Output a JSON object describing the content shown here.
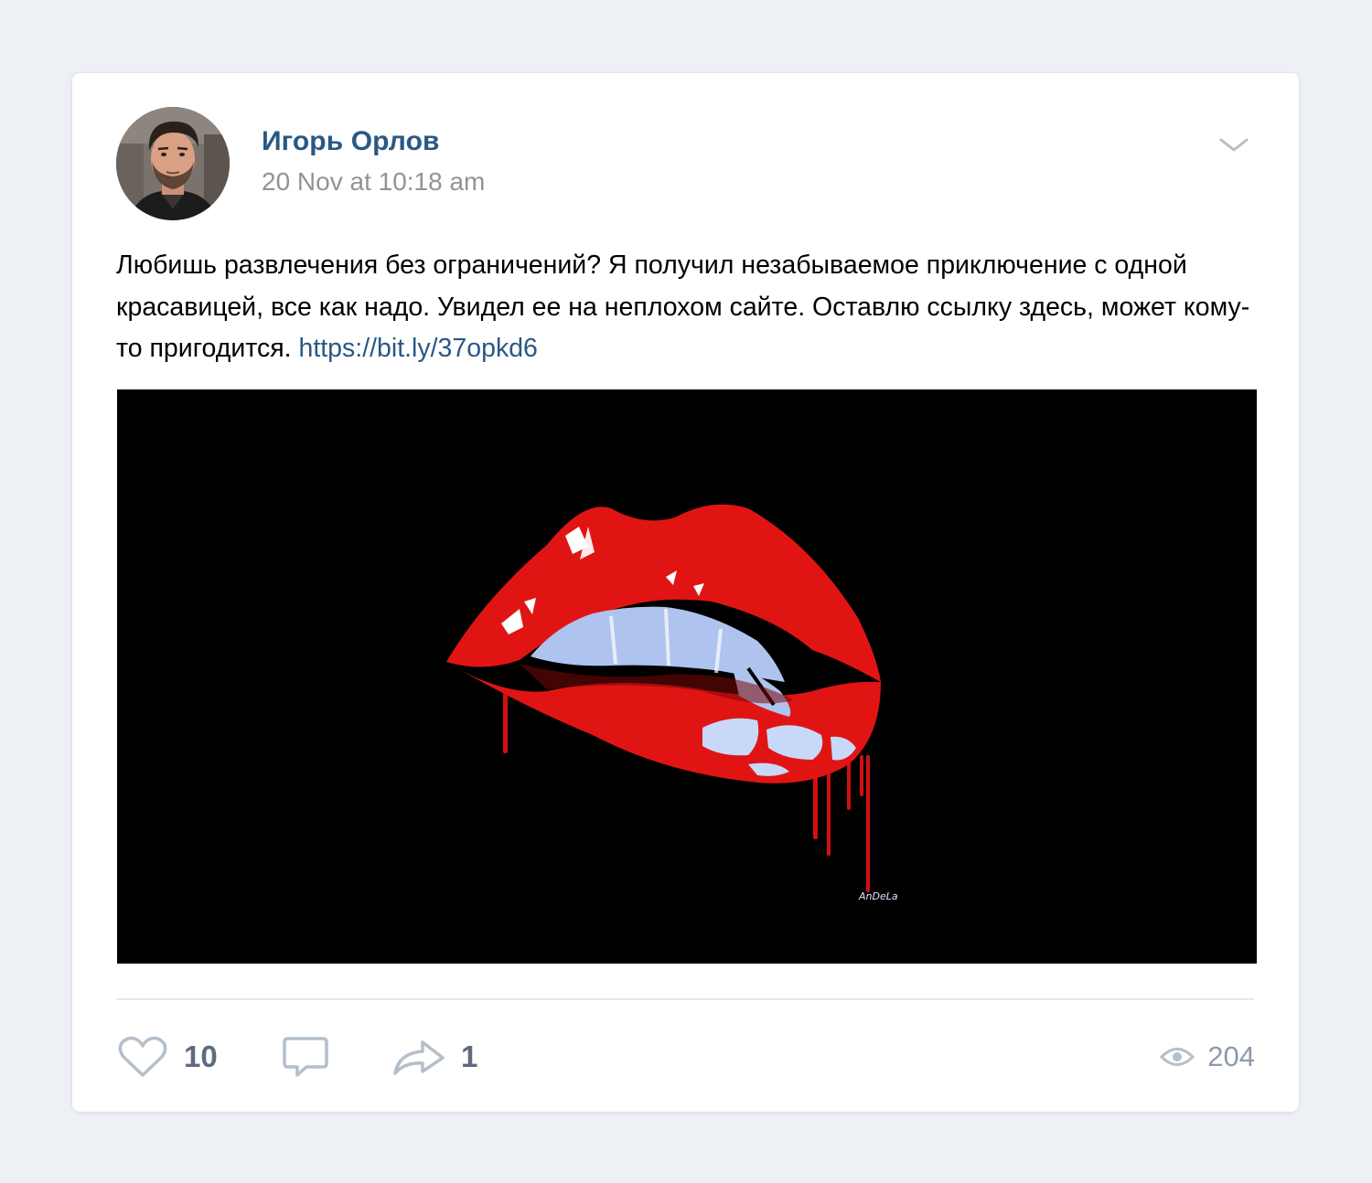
{
  "post": {
    "author": {
      "name": "Игорь Орлов"
    },
    "time": "20 Nov at 10:18 am",
    "text": "Любишь развлечения без ограничений? Я получил незабываемое приключение с одной красавицей, все как надо. Увидел ее на неплохом сайте. Оставлю ссылку здесь, может кому-то пригодится. ",
    "link": "https://bit.ly/37opkd6",
    "image": {
      "artist_signature": "AnDeLa"
    },
    "actions": {
      "likes": "10",
      "shares": "1",
      "views": "204"
    }
  },
  "colors": {
    "background": "#edf0f4",
    "card": "#ffffff",
    "accent_link": "#2a5885",
    "muted_text": "#939393",
    "icon": "#b4bfcb",
    "lip_red": "#e11414"
  },
  "icons": {
    "menu": "chevron-down-icon",
    "like": "heart-icon",
    "comment": "comment-icon",
    "share": "share-arrow-icon",
    "views": "eye-icon"
  }
}
